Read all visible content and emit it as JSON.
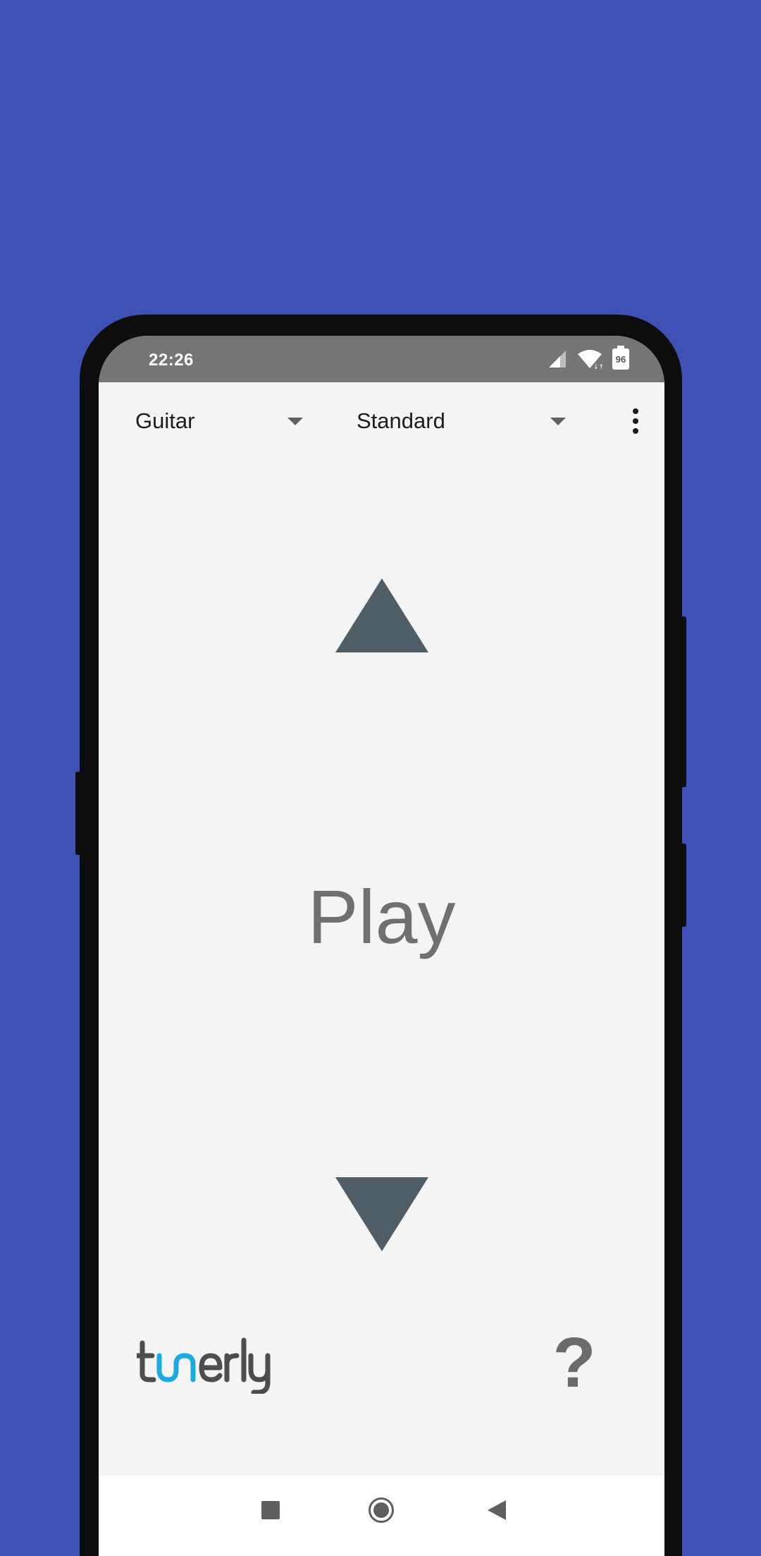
{
  "status_bar": {
    "time": "22:26",
    "battery_level": "96",
    "icons": [
      "signal-icon",
      "wifi-icon",
      "battery-icon"
    ]
  },
  "toolbar": {
    "instrument": "Guitar",
    "tuning": "Standard",
    "menu_icon": "more-vert-icon"
  },
  "tuner": {
    "main_text": "Play",
    "up_icon": "triangle-up-icon",
    "down_icon": "triangle-down-icon"
  },
  "footer": {
    "logo": "tunerly",
    "help_label": "?"
  },
  "navigation": {
    "icons": [
      "recents-icon",
      "home-icon",
      "back-icon"
    ]
  },
  "colors": {
    "background": "#3f51b5",
    "screen": "#f4f4f4",
    "status_bar": "#757575",
    "arrow": "#4e5d66",
    "logo_accent": "#1aa9e0",
    "text_muted": "#707070"
  }
}
